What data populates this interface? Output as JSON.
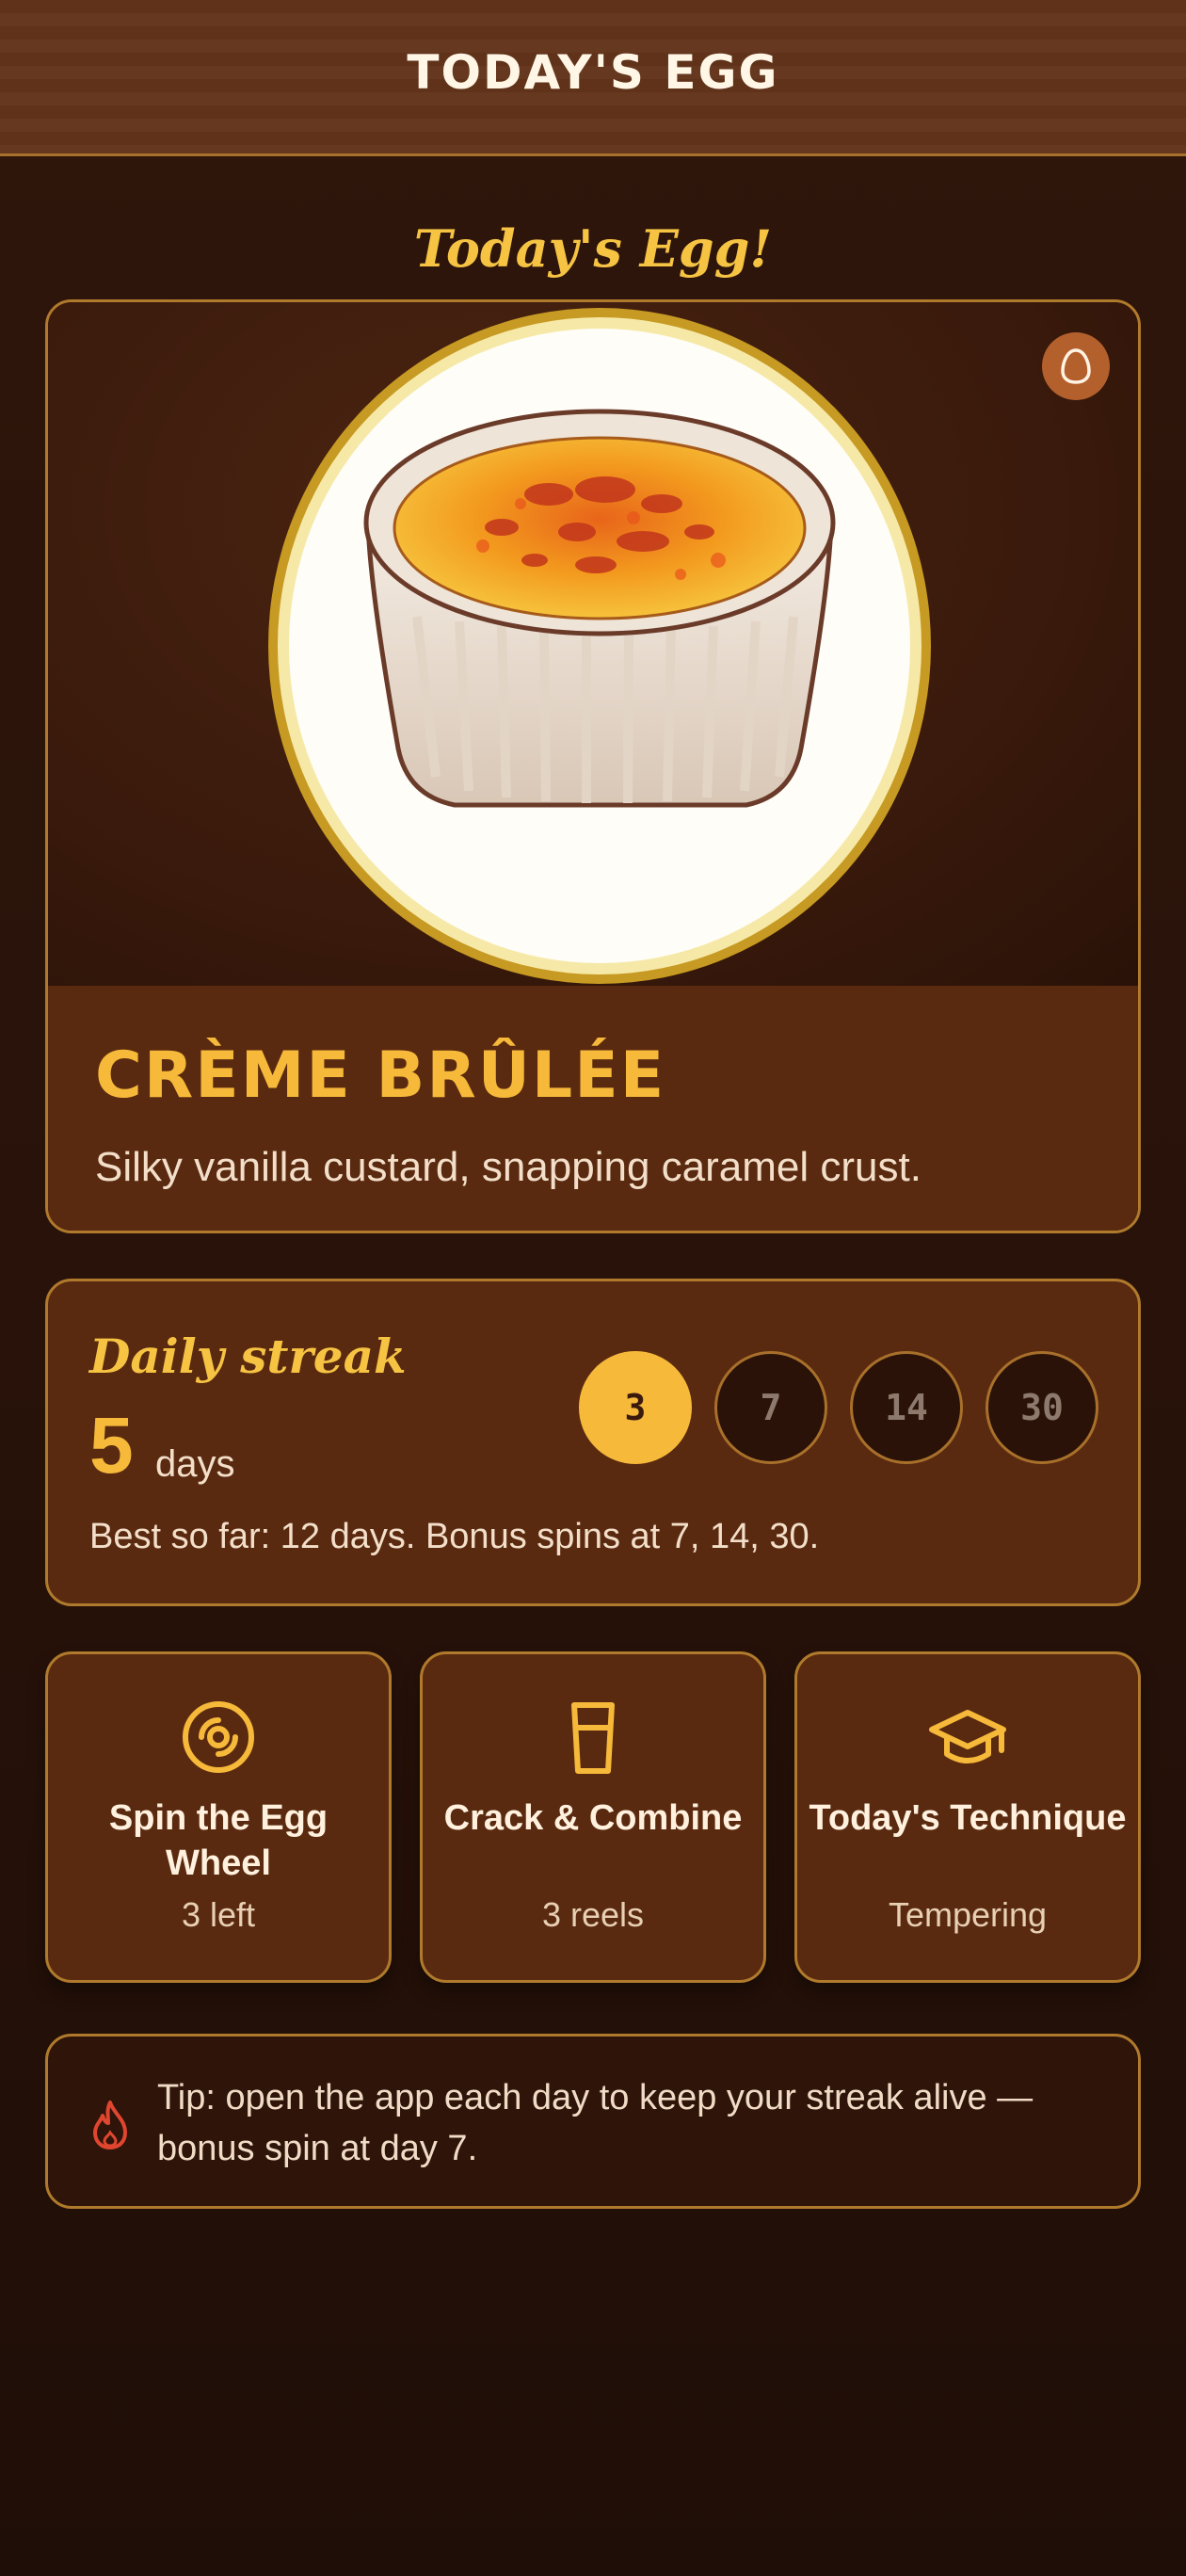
{
  "header": {
    "title": "TODAY'S EGG"
  },
  "section_heading": "Today's Egg!",
  "egg": {
    "name": "CRÈME BRÛLÉE",
    "description": "Silky vanilla custard, snapping caramel crust.",
    "image_icon": "creme-brulee-ramekin",
    "badge_icon": "egg-icon"
  },
  "streak": {
    "label": "Daily streak",
    "count": "5",
    "unit": "days",
    "milestones": [
      {
        "label": "3",
        "reached": true
      },
      {
        "label": "7",
        "reached": false
      },
      {
        "label": "14",
        "reached": false
      },
      {
        "label": "30",
        "reached": false
      }
    ],
    "best_text": "Best so far: 12 days. Bonus spins at 7, 14, 30."
  },
  "tiles": [
    {
      "title": "Spin the Egg Wheel",
      "subtitle": "3 left",
      "icon": "spin-wheel-icon"
    },
    {
      "title": "Crack & Combine",
      "subtitle": "3 reels",
      "icon": "cup-icon"
    },
    {
      "title": "Today's Technique",
      "subtitle": "Tempering",
      "icon": "graduation-cap-icon"
    }
  ],
  "tip": {
    "icon": "flame-icon",
    "text": "Tip: open the app each day to keep your streak alive — bonus spin at day 7."
  },
  "colors": {
    "accent": "#f6b93a",
    "card_border": "#b07a2c",
    "card_bg": "#5a2a10",
    "page_bg": "#221008",
    "flame": "#e0462f"
  }
}
